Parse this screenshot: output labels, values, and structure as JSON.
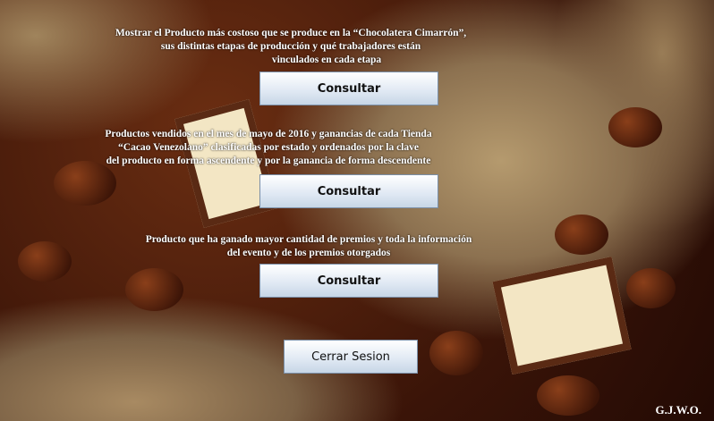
{
  "sections": [
    {
      "description_lines": [
        "Mostrar el Producto más costoso que se produce  en la “Chocolatera Cimarrón”,",
        "sus  distintas  etapas de producción y qué trabajadores están",
        "vinculados en cada etapa"
      ],
      "button_label": "Consultar"
    },
    {
      "description_lines": [
        "Productos vendidos en el mes de mayo de 2016 y ganancias de cada Tienda",
        "“Cacao Venezolano” clasificadas por estado y ordenados por la clave",
        "del producto en forma ascendente y por la ganancia de forma descendente"
      ],
      "button_label": "Consultar"
    },
    {
      "description_lines": [
        "Producto que ha ganado mayor cantidad de premios y toda la información",
        "del evento y de los premios otorgados"
      ],
      "button_label": "Consultar"
    }
  ],
  "logout_label": "Cerrar Sesion",
  "signature": "G.J.W.O."
}
